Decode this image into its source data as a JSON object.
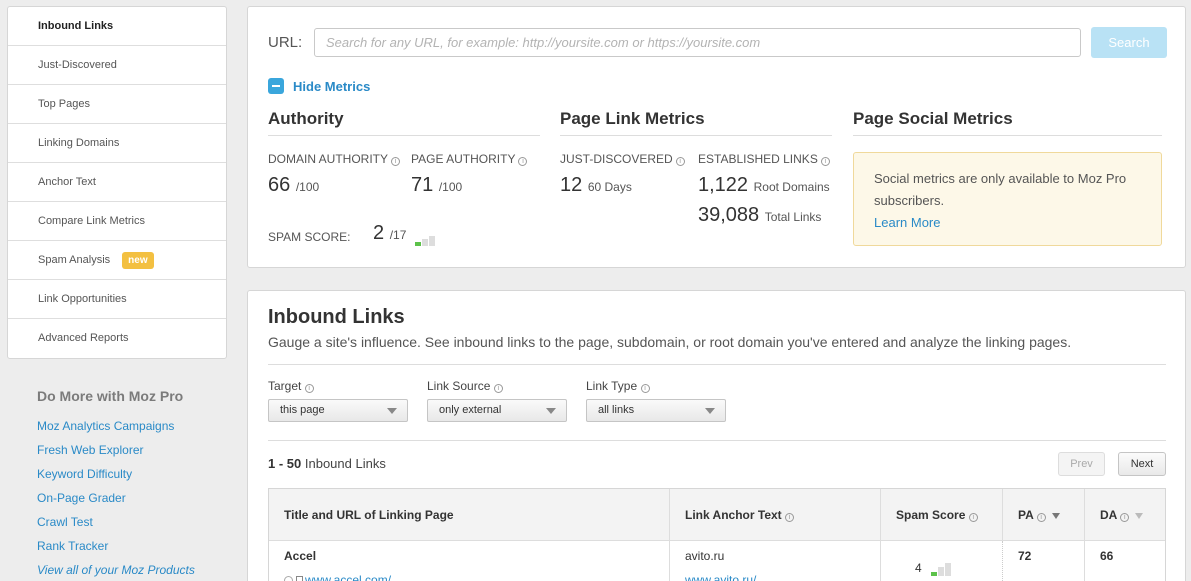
{
  "sidebar": {
    "items": [
      {
        "label": "Inbound Links"
      },
      {
        "label": "Just-Discovered"
      },
      {
        "label": "Top Pages"
      },
      {
        "label": "Linking Domains"
      },
      {
        "label": "Anchor Text"
      },
      {
        "label": "Compare Link Metrics"
      },
      {
        "label": "Spam Analysis",
        "badge": "new"
      },
      {
        "label": "Link Opportunities"
      },
      {
        "label": "Advanced Reports"
      }
    ],
    "active_index": 0
  },
  "do_more": {
    "title": "Do More with Moz Pro",
    "links": [
      "Moz Analytics Campaigns",
      "Fresh Web Explorer",
      "Keyword Difficulty",
      "On-Page Grader",
      "Crawl Test",
      "Rank Tracker",
      "View all of your Moz Products"
    ]
  },
  "search": {
    "label": "URL:",
    "placeholder": "Search for any URL, for example: http://yoursite.com or https://yoursite.com",
    "value": "",
    "button": "Search"
  },
  "toggle": {
    "label": "Hide Metrics"
  },
  "authority": {
    "title": "Authority",
    "domain_authority_label": "DOMAIN AUTHORITY",
    "domain_authority_value": "66",
    "domain_authority_max": "/100",
    "page_authority_label": "PAGE AUTHORITY",
    "page_authority_value": "71",
    "page_authority_max": "/100",
    "spam_label": "SPAM SCORE:",
    "spam_value": "2",
    "spam_max": "/17"
  },
  "page_link_metrics": {
    "title": "Page Link Metrics",
    "just_discovered_label": "JUST-DISCOVERED",
    "just_discovered_value": "12",
    "just_discovered_unit": "60 Days",
    "established_label": "ESTABLISHED LINKS",
    "root_domains_value": "1,122",
    "root_domains_unit": "Root Domains",
    "total_links_value": "39,088",
    "total_links_unit": "Total Links"
  },
  "social": {
    "title": "Page Social Metrics",
    "message": "Social metrics are only available to Moz Pro subscribers.",
    "link": "Learn More"
  },
  "inbound": {
    "title": "Inbound Links",
    "description": "Gauge a site's influence. See inbound links to the page, subdomain, or root domain you've entered and analyze the linking pages.",
    "filters": [
      {
        "label": "Target",
        "value": "this page"
      },
      {
        "label": "Link Source",
        "value": "only external"
      },
      {
        "label": "Link Type",
        "value": "all links"
      }
    ],
    "count_range": "1 - 50",
    "count_text": "Inbound Links",
    "prev": "Prev",
    "next": "Next",
    "columns": [
      "Title and URL of Linking Page",
      "Link Anchor Text",
      "Spam Score",
      "PA",
      "DA"
    ],
    "rows": [
      {
        "title": "Accel",
        "url": "www.accel.com/",
        "anchor_text": "avito.ru",
        "anchor_url": "www.avito.ru/",
        "spam_score": "4",
        "pa": "72",
        "da": "66"
      }
    ]
  },
  "colors": {
    "link": "#2a8ac7",
    "accent_blue": "#3aa6dc",
    "search_button": "#b9e2f5",
    "badge": "#f3c041",
    "spam_good": "#5cc24a"
  }
}
